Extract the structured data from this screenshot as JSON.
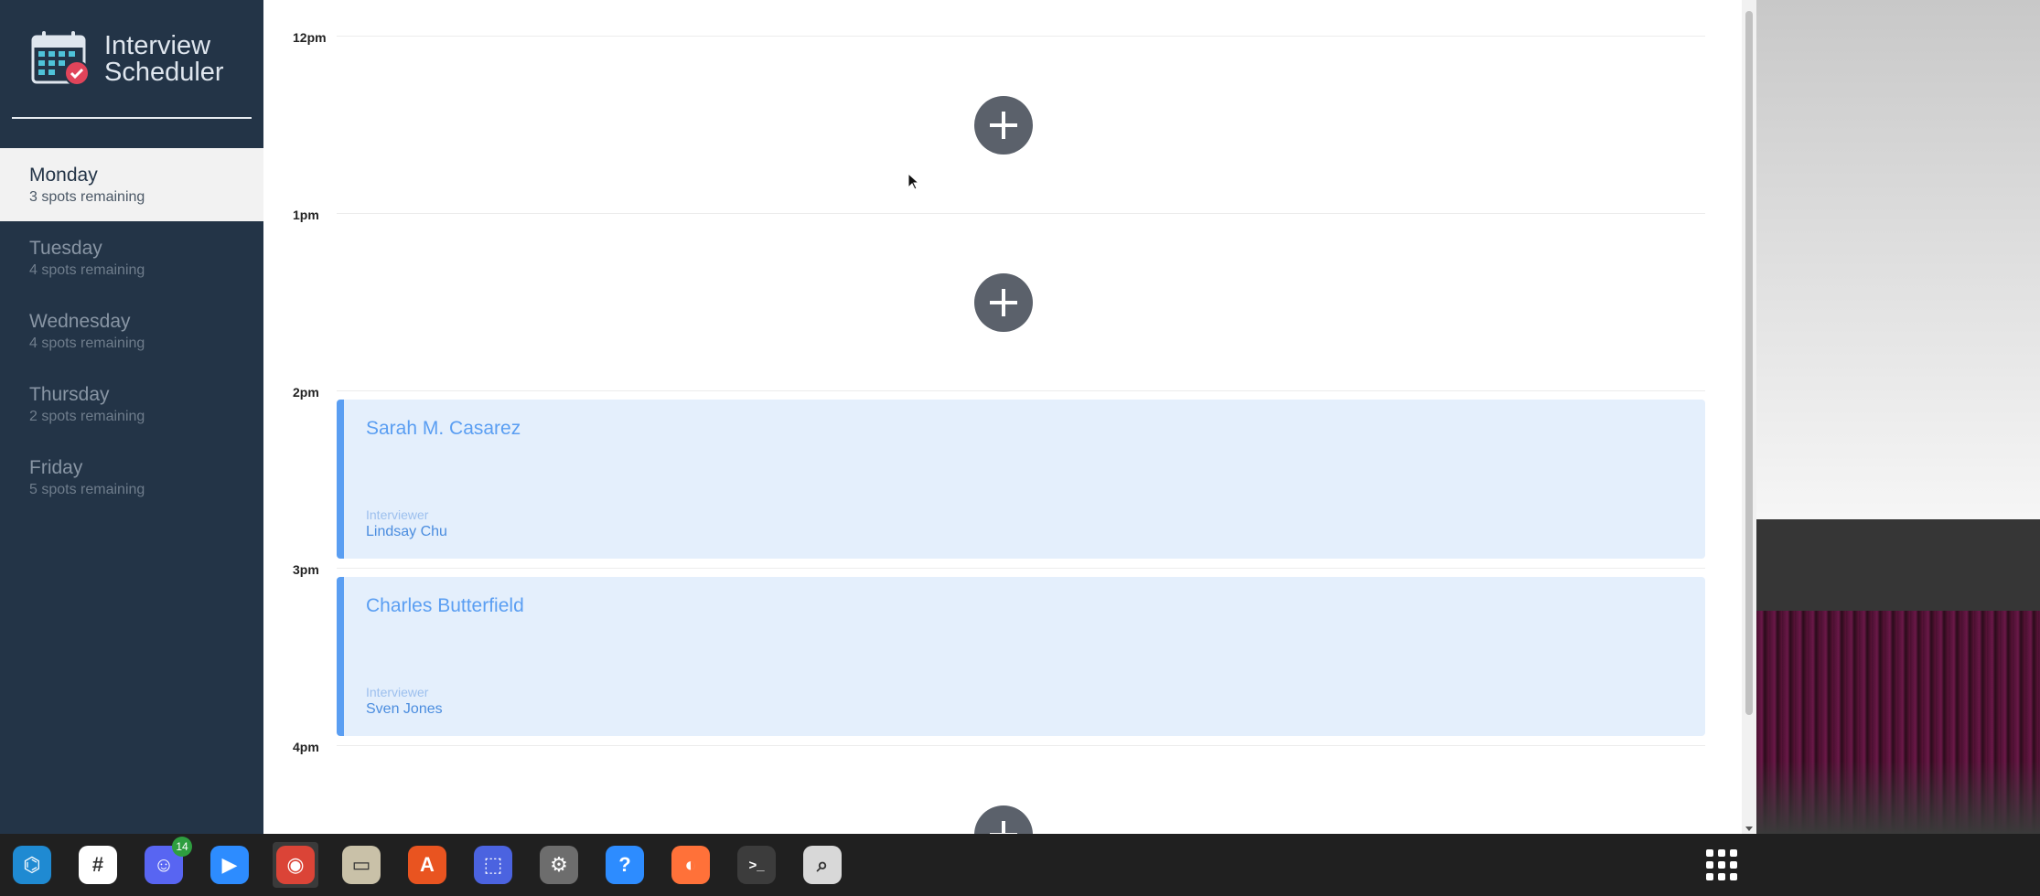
{
  "app": {
    "title_line1": "Interview",
    "title_line2": "Scheduler"
  },
  "days": [
    {
      "name": "Monday",
      "spots": "3 spots remaining",
      "selected": true
    },
    {
      "name": "Tuesday",
      "spots": "4 spots remaining",
      "selected": false
    },
    {
      "name": "Wednesday",
      "spots": "4 spots remaining",
      "selected": false
    },
    {
      "name": "Thursday",
      "spots": "2 spots remaining",
      "selected": false
    },
    {
      "name": "Friday",
      "spots": "5 spots remaining",
      "selected": false
    }
  ],
  "slots": [
    {
      "time": "12pm"
    },
    {
      "time": "1pm"
    },
    {
      "time": "2pm",
      "student": "Sarah M. Casarez",
      "interviewer_label": "Interviewer",
      "interviewer": "Lindsay Chu"
    },
    {
      "time": "3pm",
      "student": "Charles Butterfield",
      "interviewer_label": "Interviewer",
      "interviewer": "Sven Jones"
    },
    {
      "time": "4pm"
    }
  ],
  "taskbar": {
    "apps": [
      {
        "name": "vscode-icon",
        "color": "#1f8ad2",
        "glyph": "⌬"
      },
      {
        "name": "slack-icon",
        "color": "#ffffff",
        "glyph": "#"
      },
      {
        "name": "discord-icon",
        "color": "#5865f2",
        "glyph": "☺",
        "badge": "14"
      },
      {
        "name": "zoom-icon",
        "color": "#2d8cff",
        "glyph": "▶"
      },
      {
        "name": "chrome-icon",
        "color": "#db4437",
        "glyph": "◉"
      },
      {
        "name": "files-icon",
        "color": "#c9c1a8",
        "glyph": "▭"
      },
      {
        "name": "software-center-icon",
        "color": "#e95420",
        "glyph": "A"
      },
      {
        "name": "screenshot-icon",
        "color": "#4b63e0",
        "glyph": "⬚"
      },
      {
        "name": "settings-icon",
        "color": "#6d6d6d",
        "glyph": "⚙"
      },
      {
        "name": "help-icon",
        "color": "#2d8cff",
        "glyph": "?"
      },
      {
        "name": "firefox-icon",
        "color": "#ff7139",
        "glyph": "◐"
      },
      {
        "name": "terminal-icon",
        "color": "#3c3c3c",
        "glyph": ">_"
      },
      {
        "name": "image-viewer-icon",
        "color": "#d8d8d8",
        "glyph": "⌕"
      }
    ]
  },
  "colors": {
    "sidebar_bg": "#233447",
    "accent": "#5a9ef2",
    "appointment_bg": "#e4effc",
    "add_button": "#5b616b"
  }
}
